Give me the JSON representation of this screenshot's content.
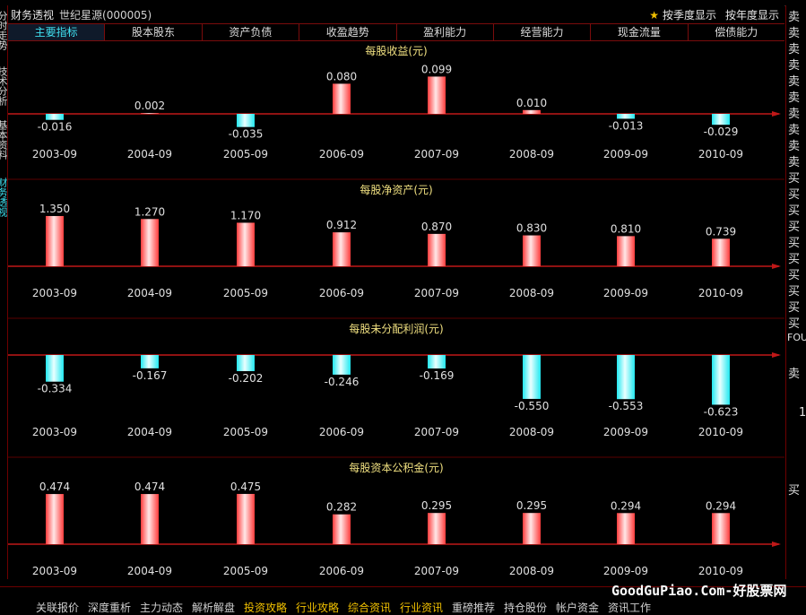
{
  "header": {
    "title": "财务透视",
    "stock": "世纪星源(000005)",
    "quarterly_label": "按季度显示",
    "yearly_label": "按年度显示"
  },
  "tabs": [
    "主要指标",
    "股本股东",
    "资产负债",
    "收盈趋势",
    "盈利能力",
    "经营能力",
    "现金流量",
    "偿债能力"
  ],
  "left_tabs": [
    "分时走势",
    "技术分析",
    "基本资料",
    "财务透视"
  ],
  "right_panel": {
    "sell_label": "卖",
    "buy_label": "买",
    "sell_rows": 10,
    "buy_rows": 10,
    "status_text": "FOU",
    "lower_sell": "卖",
    "lower_value": "1",
    "lower_buy": "买"
  },
  "bottom_bar": [
    "关联报价",
    "深度重析",
    "主力动态",
    "解析解盘",
    "投资攻略",
    "行业攻略",
    "综合资讯",
    "行业资讯",
    "重磅推荐",
    "持仓股份",
    "帐户资金",
    "资讯工作"
  ],
  "watermark": "GoodGuPiao.Com-好股票网",
  "colors": {
    "positive_bar": "#ff5a5a",
    "negative_bar": "#40f0f0",
    "axis": "#c01818",
    "label": "#e0e0e0",
    "title": "#f0e080"
  },
  "chart_data": [
    {
      "type": "bar",
      "title": "每股收益(元)",
      "categories": [
        "2003-09",
        "2004-09",
        "2005-09",
        "2006-09",
        "2007-09",
        "2008-09",
        "2009-09",
        "2010-09"
      ],
      "values": [
        -0.016,
        0.002,
        -0.035,
        0.08,
        0.099,
        0.01,
        -0.013,
        -0.029
      ],
      "labels": [
        "-0.016",
        "0.002",
        "-0.035",
        "0.080",
        "0.099",
        "0.010",
        "-0.013",
        "-0.029"
      ]
    },
    {
      "type": "bar",
      "title": "每股净资产(元)",
      "categories": [
        "2003-09",
        "2004-09",
        "2005-09",
        "2006-09",
        "2007-09",
        "2008-09",
        "2009-09",
        "2010-09"
      ],
      "values": [
        1.35,
        1.27,
        1.17,
        0.912,
        0.87,
        0.83,
        0.81,
        0.739
      ],
      "labels": [
        "1.350",
        "1.270",
        "1.170",
        "0.912",
        "0.870",
        "0.830",
        "0.810",
        "0.739"
      ]
    },
    {
      "type": "bar",
      "title": "每股未分配利润(元)",
      "categories": [
        "2003-09",
        "2004-09",
        "2005-09",
        "2006-09",
        "2007-09",
        "2008-09",
        "2009-09",
        "2010-09"
      ],
      "values": [
        -0.334,
        -0.167,
        -0.202,
        -0.246,
        -0.169,
        -0.55,
        -0.553,
        -0.623
      ],
      "labels": [
        "-0.334",
        "-0.167",
        "-0.202",
        "-0.246",
        "-0.169",
        "-0.550",
        "-0.553",
        "-0.623"
      ]
    },
    {
      "type": "bar",
      "title": "每股资本公积金(元)",
      "categories": [
        "2003-09",
        "2004-09",
        "2005-09",
        "2006-09",
        "2007-09",
        "2008-09",
        "2009-09",
        "2010-09"
      ],
      "values": [
        0.474,
        0.474,
        0.475,
        0.282,
        0.295,
        0.295,
        0.294,
        0.294
      ],
      "labels": [
        "0.474",
        "0.474",
        "0.475",
        "0.282",
        "0.295",
        "0.295",
        "0.294",
        "0.294"
      ]
    }
  ]
}
